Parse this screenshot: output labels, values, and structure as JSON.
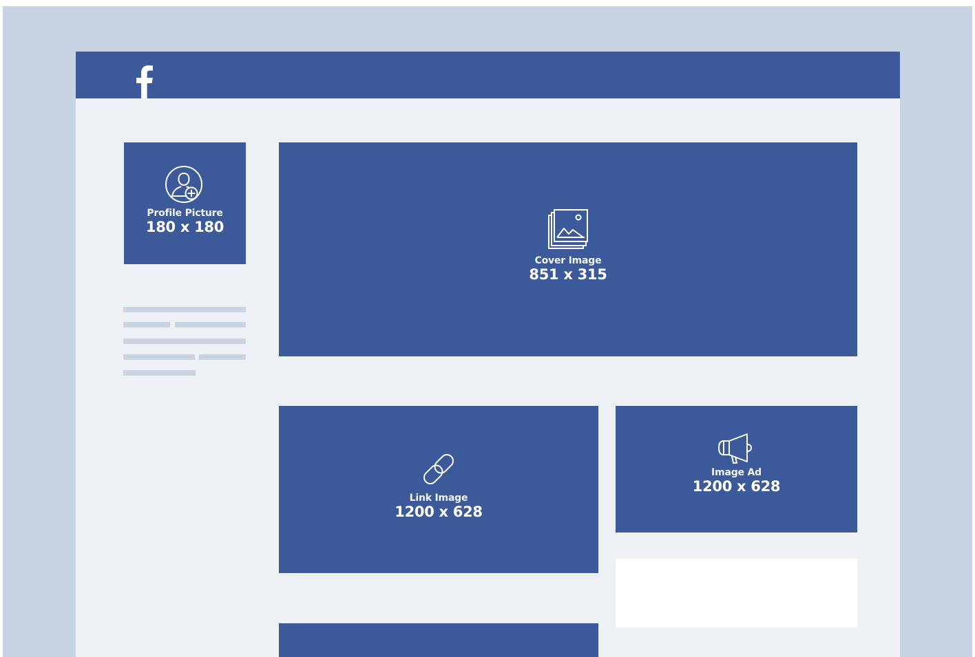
{
  "header": {
    "logo_icon": "facebook-f-icon"
  },
  "colors": {
    "page_background": "#c5d3e3",
    "content_background": "#edf1f5",
    "brand_blue": "#3c5a99",
    "placeholder_line": "#c9d4e2",
    "card_white": "#ffffff"
  },
  "profile_picture": {
    "icon": "add-user-icon",
    "label": "Profile Picture",
    "size": "180 x 180"
  },
  "cover_image": {
    "icon": "image-stack-icon",
    "label": "Cover Image",
    "size": "851 x 315"
  },
  "link_image": {
    "icon": "link-icon",
    "label": "Link Image",
    "size": "1200 x 628"
  },
  "image_ad": {
    "icon": "megaphone-icon",
    "label": "Image Ad",
    "size": "1200 x 628"
  }
}
